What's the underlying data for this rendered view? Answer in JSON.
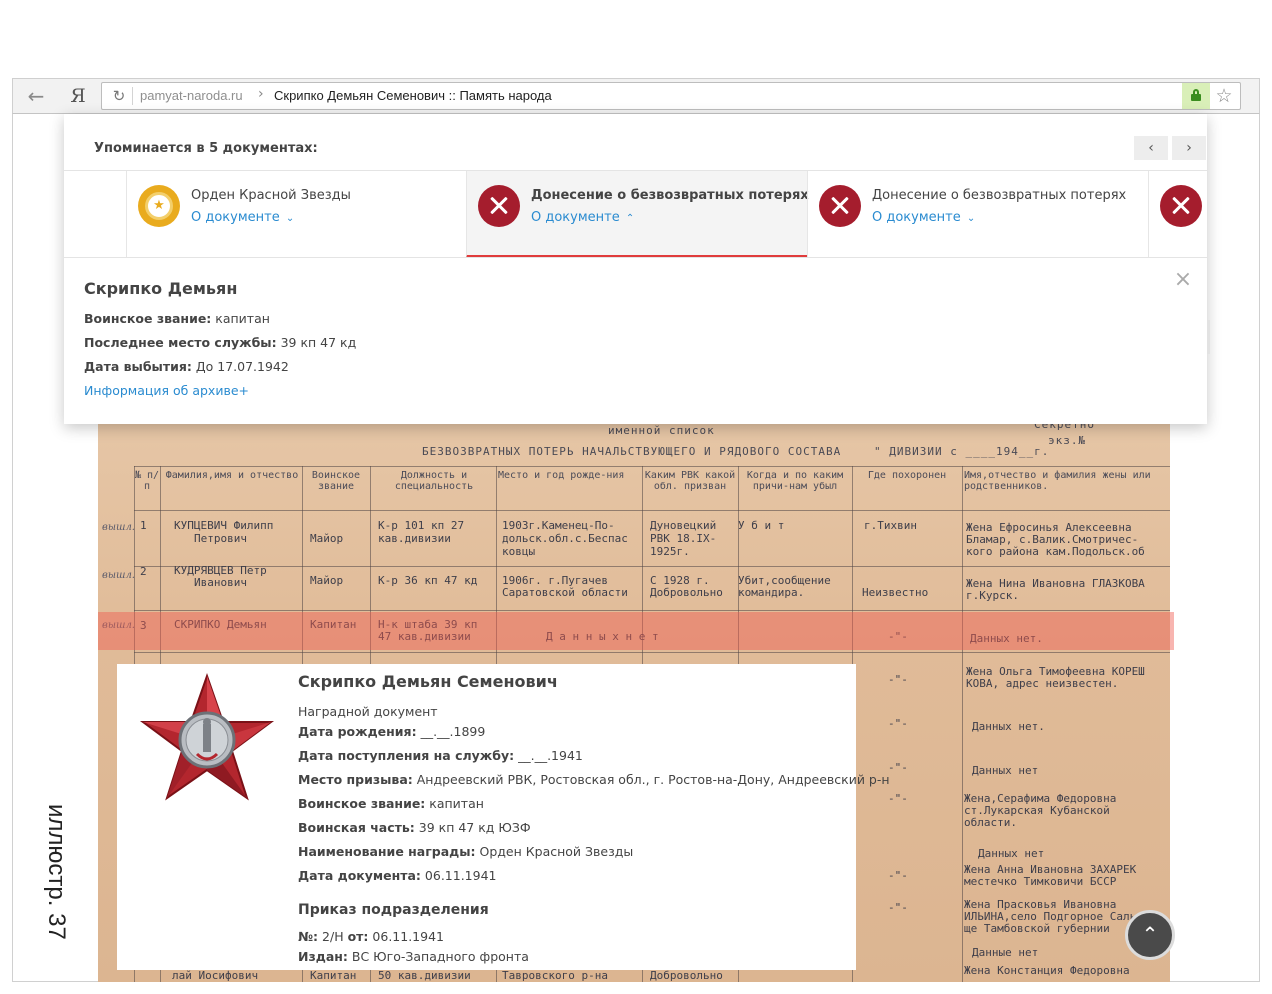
{
  "browser": {
    "back_glyph": "←",
    "logo_glyph": "Я",
    "reload_glyph": "↻",
    "url_domain": "pamyat-naroda.ru",
    "url_separator": "›",
    "url_title": "Скрипко Демьян Семенович :: Память народа",
    "bookmark_glyph": "☆"
  },
  "mentions": {
    "title": "Упоминается в 5 документах:",
    "prev_glyph": "‹",
    "next_glyph": "›",
    "tabs": [
      {
        "label": "Орден Красной Звезды",
        "link": "О документе",
        "chevron": "⌄",
        "icon": "medal-icon"
      },
      {
        "label": "Донесение о безвозвратных потерях",
        "link": "О документе",
        "chevron": "⌃",
        "icon": "cross-icon",
        "active": true
      },
      {
        "label": "Донесение о безвозвратных потерях",
        "link": "О документе",
        "chevron": "⌄",
        "icon": "cross-icon"
      },
      {
        "label": "",
        "link": "",
        "icon": "cross-icon"
      }
    ],
    "detail": {
      "close_glyph": "×",
      "name": "Скрипко Демьян",
      "rank_label": "Воинское звание:",
      "rank_value": "капитан",
      "service_label": "Последнее место службы:",
      "service_value": "39 кп 47 кд",
      "date_label": "Дата выбытия:",
      "date_value": "До 17.07.1942",
      "archive_link": "Информация об архиве+"
    }
  },
  "scan": {
    "header_top": "именной список",
    "header_secret": "Секретно",
    "header_copy": "экз.№",
    "header_main": "БЕЗВОЗВРАТНЫХ ПОТЕРЬ НАЧАЛЬСТВУЮЩЕГО И РЯДОВОГО СОСТАВА",
    "header_division": "\" ДИВИЗИИ с ____194__г.",
    "columns": [
      "№ п/п",
      "Фамилия,имя и отчество",
      "Воинское звание",
      "Должность и специальность",
      "Место и год рожде-ния",
      "Каким РВК какой обл. призван",
      "Когда и по каким причи-нам убыл",
      "Где похоронен",
      "Имя,отчество и фамилия жены или родственников."
    ],
    "rows": [
      {
        "num": "1",
        "name1": "КУПЦЕВИЧ Филипп",
        "name2": "Петрович",
        "rank": "Майор",
        "pos1": "К-р 101 кп 27",
        "pos2": "кав.дивизии",
        "birth1": "1903г.Каменец-По-",
        "birth2": "дольск.обл.с.Беспас",
        "birth3": "ковцы",
        "rvk1": "Дуновецкий",
        "rvk2": "РВК 18.IX-",
        "rvk3": "1925г.",
        "when1": "У б и т",
        "buried": "г.Тихвин",
        "rel1": "Жена Ефросинья Алексеевна",
        "rel2": "Бламар, с.Валик.Смотричес-",
        "rel3": "кого района кам.Подольск.об"
      },
      {
        "num": "2",
        "name1": "КУДРЯВЦЕВ Петр",
        "name2": "Иванович",
        "rank": "Майор",
        "pos1": "К-р 36 кп 47 кд",
        "birth1": "1906г. г.Пугачев",
        "birth2": "Саратовской области",
        "rvk1": "С 1928 г.",
        "rvk2": "Добровольно",
        "when1": "Убит,сообщение",
        "when2": "командира.",
        "buried": "Неизвестно",
        "rel1": "Жена Нина Ивановна ГЛАЗКОВА",
        "rel2": "г.Курск."
      },
      {
        "num": "3",
        "name1": "СКРИПКО Демьян",
        "rank": "Капитан",
        "pos1": "Н-к штаба 39 кп",
        "pos2": "47 кав.дивизии",
        "birth1": "Д  а  н  н  ы  х      н  е  т",
        "buried": "-\"-",
        "rel1": "Данных нет."
      }
    ],
    "lower_cells": [
      "-\"-",
      "Жена Ольга Тимофеевна КОРЕШ",
      "КОВА, адрес неизвестен.",
      "-\"-",
      "Данных нет.",
      "-\"-",
      "Данных нет",
      "-\"-",
      "Жена,Серафима Федоровна",
      "ст.Лукарская Кубанской",
      "области.",
      "Данных нет",
      "-\"-",
      "Жена Анна Ивановна ЗАХАРЕК",
      "местечко Тимковичи БССР",
      "-\"-",
      "Жена Прасковья Ивановна",
      "ИЛЬИНА,село Подгорное Саль",
      "ще Тамбовской губернии",
      "Данные нет",
      "Жена Констанция Федоровна",
      "лай Иосифович",
      "Капитан",
      "50 кав.дивизии",
      "Тавровского р-на",
      "Добровольно"
    ],
    "margin_notes": [
      "вышл.",
      "вышл.",
      "вышл."
    ]
  },
  "award": {
    "name": "Скрипко Демьян Семенович",
    "doc_type": "Наградной документ",
    "birth_label": "Дата рождения:",
    "birth_value": "__.__.1899",
    "enlist_label": "Дата поступления на службу:",
    "enlist_value": "__.__.1941",
    "draft_label": "Место призыва:",
    "draft_value": "Андреевский РВК, Ростовская обл., г. Ростов-на-Дону, Андреевский р-н",
    "rank_label": "Воинское звание:",
    "rank_value": "капитан",
    "unit_label": "Воинская часть:",
    "unit_value": "39 кп 47 кд ЮЗФ",
    "award_label": "Наименование награды:",
    "award_value": "Орден Красной Звезды",
    "docdate_label": "Дата документа:",
    "docdate_value": "06.11.1941",
    "order_title": "Приказ подразделения",
    "order_num_label": "№:",
    "order_num_value": "2/Н",
    "order_from_label": "от:",
    "order_from_value": "06.11.1941",
    "issued_label": "Издан:",
    "issued_value": "ВС Юго-Западного фронта"
  },
  "caption": "иллюстр. 37",
  "scroll_top_glyph": "⌃",
  "colors": {
    "accent_red": "#a51d2d",
    "tab_underline": "#e03b3b",
    "link_blue": "#2a8bd0",
    "medal_gold": "#e9ab1e",
    "secure_green": "#3a8d1f"
  }
}
